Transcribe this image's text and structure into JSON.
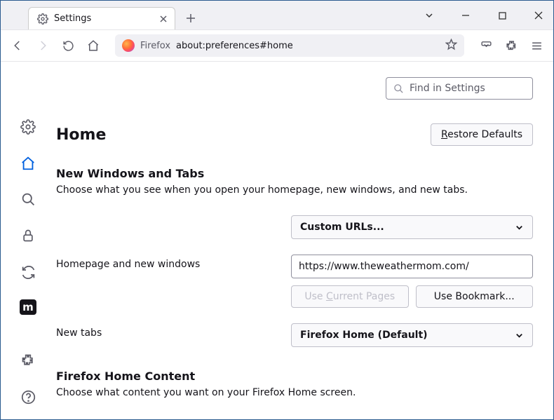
{
  "tab": {
    "title": "Settings"
  },
  "urlbar": {
    "identity": "Firefox",
    "url": "about:preferences#home"
  },
  "search": {
    "placeholder": "Find in Settings"
  },
  "page": {
    "title": "Home",
    "restore_defaults": "Restore Defaults"
  },
  "section1": {
    "title": "New Windows and Tabs",
    "desc": "Choose what you see when you open your homepage, new windows, and new tabs."
  },
  "homepage": {
    "label_row": "Homepage and new windows",
    "mode_select": "Custom URLs...",
    "url_value": "https://www.theweathermom.com/",
    "use_current": "Use Current Pages",
    "use_bookmark": "Use Bookmark..."
  },
  "newtabs": {
    "label": "New tabs",
    "select": "Firefox Home (Default)"
  },
  "section2": {
    "title": "Firefox Home Content",
    "desc": "Choose what content you want on your Firefox Home screen."
  }
}
